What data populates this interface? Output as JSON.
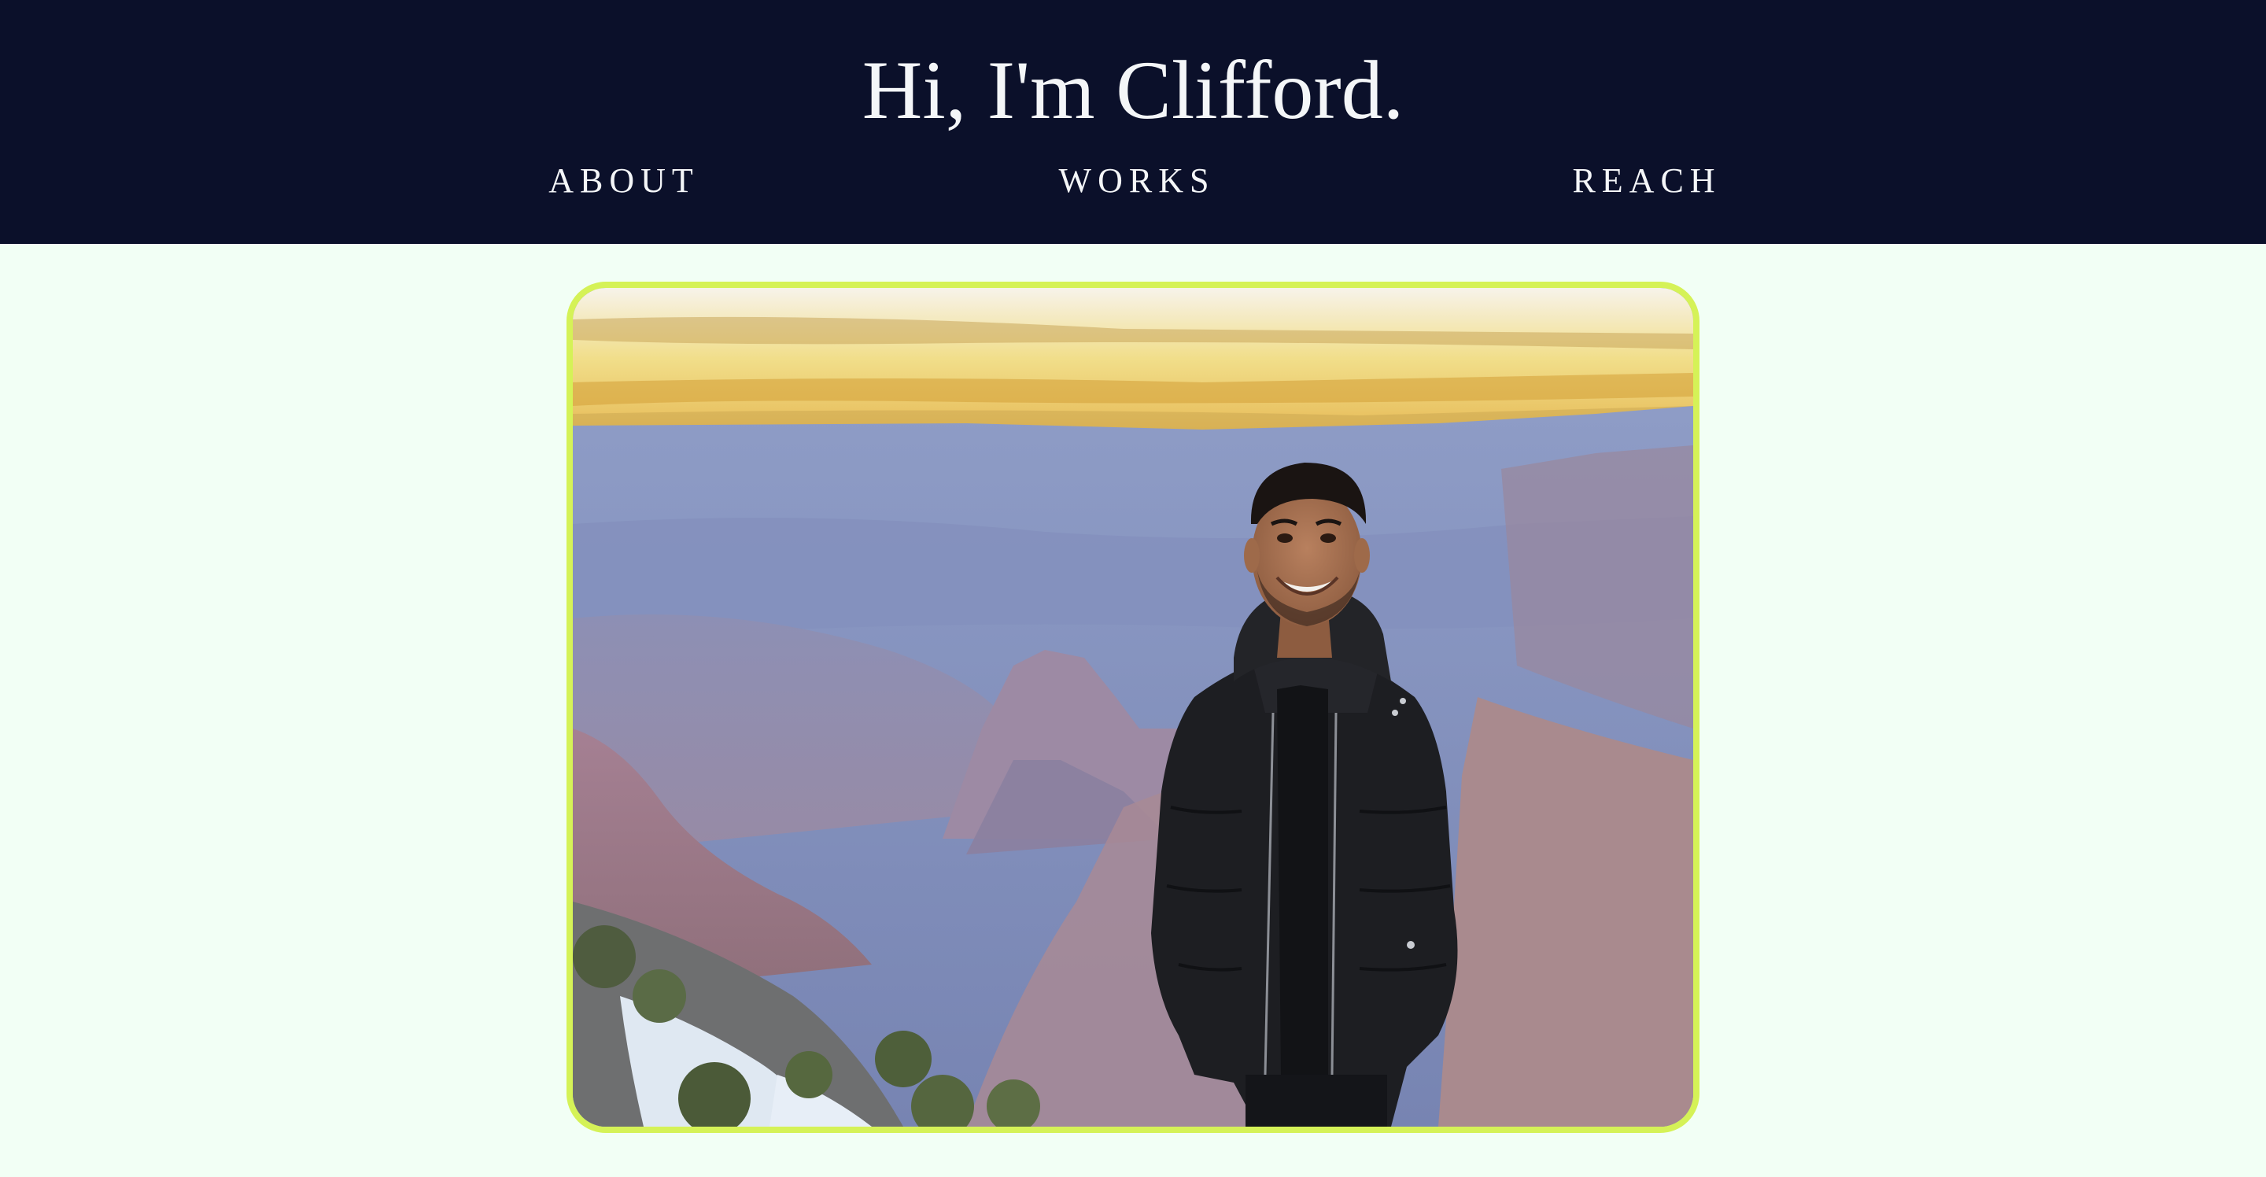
{
  "header": {
    "title": "Hi, I'm Clifford.",
    "background_color": "#0b102a",
    "text_color": "#f4f6f8"
  },
  "nav": {
    "items": [
      {
        "label": "ABOUT"
      },
      {
        "label": "WORKS"
      },
      {
        "label": "REACH"
      }
    ]
  },
  "hero": {
    "image_subject": "portrait-photo",
    "frame_color": "#d5f257"
  },
  "page": {
    "background_color": "#f2fff5"
  }
}
